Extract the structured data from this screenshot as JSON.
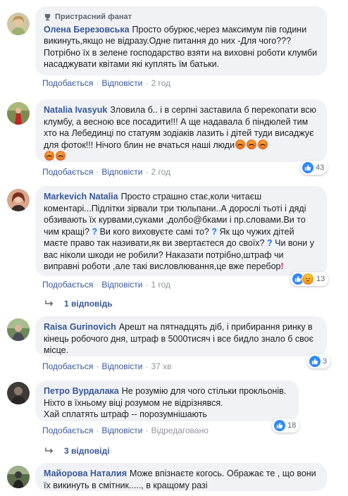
{
  "labels": {
    "like": "Подобається",
    "reply": "Відповісти",
    "dot": "·"
  },
  "comments": [
    {
      "badge": "Пристрасний фанат",
      "author": "Олена Березовська",
      "text": "Просто обурює,через максимум пів години викинуть,якщо не відразу.Одне питання до них -Для чого??? Потрібно їх в зелене господарство взяти на виховні роботи клумби насаджувати квітами які куплять їм батьки.",
      "time": "2 год"
    },
    {
      "author": "Natalia Ivasyuk",
      "text": "Зловила б.. і в серпні заставила б перекопати всю клумбу, а весною все посадити!!! А ще надавала б піндюлей тим хто на Лебединці по статуям зодіаків лазить і дітей туди висаджує для фоток!!! Нічого блин не вчаться наші люди",
      "time": "2 год",
      "reaction_count": "43"
    },
    {
      "author": "Markevich Natalia",
      "text_a": "Просто страшно стає,коли читаєш коментарі...Підлітки зірвали три тюльпани..А дорослі тьоті і дяді обзивають їх курвами,суками ,долбо@бками і пр.словами.Ви то чим кращі?",
      "text_b": "Ви кого виховуєте самі то?",
      "text_c": "Як що чужих дітей маєте право так називати,як ви звертаєтеся до своїх?",
      "text_d": "Чи вони у вас ніколи шкоди не робили? Наказати потрібно,штраф чи виправні роботи ,але такі висловлювання,це вже перебор",
      "time": "1 год",
      "reaction_count": "13",
      "replies": "1 відповідь"
    },
    {
      "author": "Raisa Gurinovich",
      "text": "Арешт на пятнадцять діб, і прибирання ринку в кінець робочого дня, штраф в 5000тисяч і все бидло знало б своє місце.",
      "time": "37 хв",
      "reaction_count": "3"
    },
    {
      "author": "Петро Вурдалака",
      "text_lines": [
        "Не розумію для чого стільки прокльонів.",
        "Ніхто в їхньому віці розумом не відрізнявся.",
        "Хай сплатять штраф -- порозумнішають"
      ],
      "edited": "Відредаговано",
      "reaction_count": "18",
      "replies": "3 відповіді"
    },
    {
      "author": "Майорова Наталия",
      "text": "Може впізнаєте когось. Ображає те , що вони їх викинуть в смітник....., в кращому разі"
    }
  ],
  "colors": {
    "author": "#385898",
    "bubble": "#f0f2f5",
    "like_blue": "#2e89ff",
    "meta_grey": "#90949c"
  }
}
